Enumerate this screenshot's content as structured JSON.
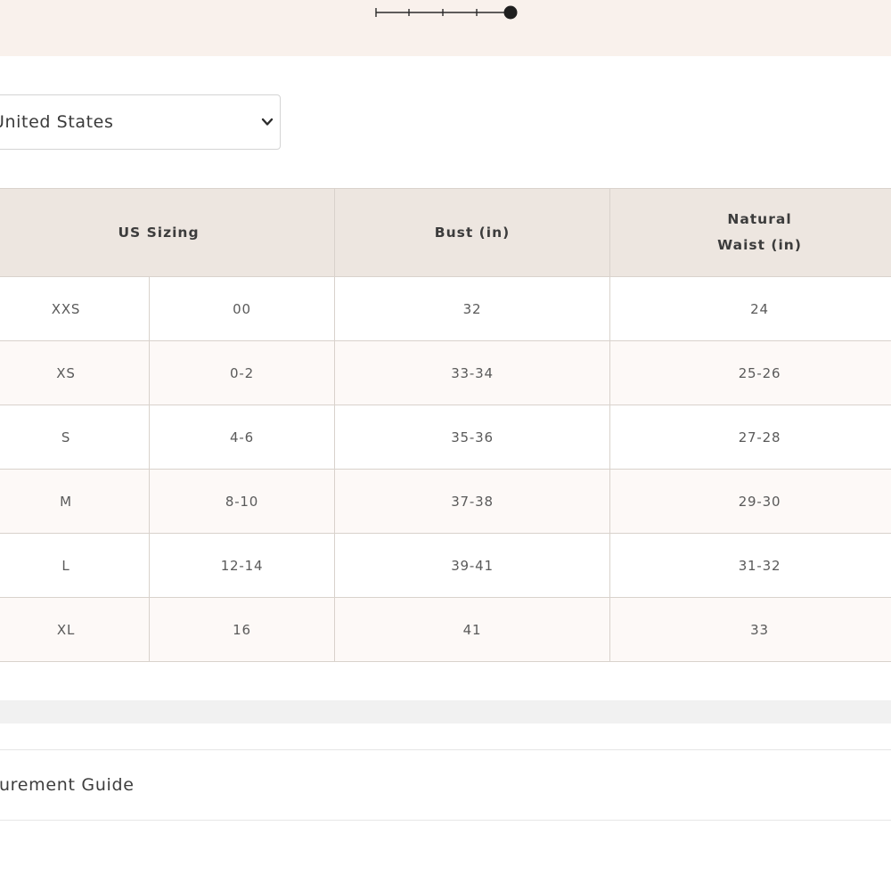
{
  "fit_slider": {
    "steps": 5,
    "selected_step": 5
  },
  "region_select": {
    "value": "United States",
    "icon": "chevron-down-icon"
  },
  "size_table": {
    "headers": {
      "us_sizing": "US Sizing",
      "bust": "Bust (in)",
      "waist_line1": "Natural",
      "waist_line2": "Waist (in)"
    },
    "rows": [
      {
        "size": "XXS",
        "us": "00",
        "bust": "32",
        "waist": "24"
      },
      {
        "size": "XS",
        "us": "0-2",
        "bust": "33-34",
        "waist": "25-26"
      },
      {
        "size": "S",
        "us": "4-6",
        "bust": "35-36",
        "waist": "27-28"
      },
      {
        "size": "M",
        "us": "8-10",
        "bust": "37-38",
        "waist": "29-30"
      },
      {
        "size": "L",
        "us": "12-14",
        "bust": "39-41",
        "waist": "31-32"
      },
      {
        "size": "XL",
        "us": "16",
        "bust": "41",
        "waist": "33"
      }
    ]
  },
  "measurement_guide": {
    "label": "asurement Guide"
  },
  "colors": {
    "top_band": "#f9f1ec",
    "header_bg": "#ede6e0",
    "alt_row_bg": "#fdf9f7",
    "border": "#d9d2cc"
  }
}
